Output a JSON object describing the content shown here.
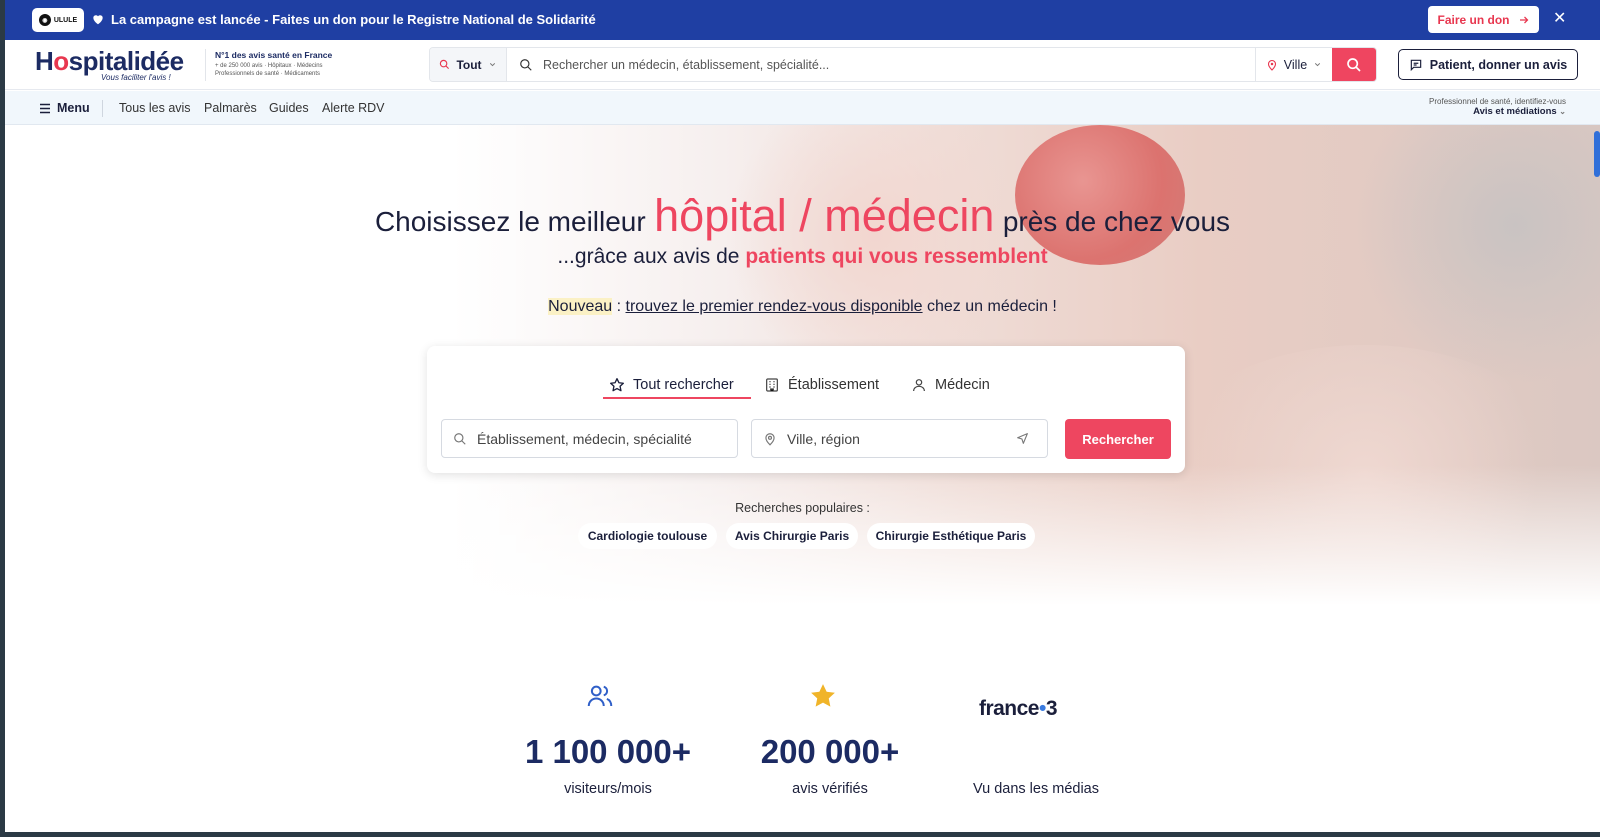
{
  "banner": {
    "logo_text": "ULULE",
    "message": "La campagne est lancée - Faites un don pour le Registre National de Solidarité",
    "donate_label": "Faire un don",
    "close_icon": "close-icon"
  },
  "header": {
    "logo_name": "Hospitalidée",
    "logo_tagline": "Vous faciliter l'avis !",
    "meta_title": "N°1 des avis santé en France",
    "meta_line1": "+ de 250 000 avis · Hôpitaux · Médecins",
    "meta_line2": "Professionnels de santé · Médicaments",
    "search_scope": "Tout",
    "search_placeholder": "Rechercher un médecin, établissement, spécialité...",
    "city_label": "Ville",
    "review_button": "Patient, donner un avis"
  },
  "nav": {
    "menu_label": "Menu",
    "links": [
      "Tous les avis",
      "Palmarès",
      "Guides",
      "Alerte RDV"
    ],
    "pro_line1": "Professionnel de santé, identifiez-vous",
    "pro_line2": "Avis et médiations"
  },
  "hero": {
    "headline_pre": "Choisissez le meilleur",
    "headline_highlight": "hôpital / médecin",
    "headline_post": "près de chez vous",
    "sub_pre": "...grâce aux avis de",
    "sub_highlight": "patients qui vous ressemblent",
    "nouveau_tag": "Nouveau",
    "nouveau_sep": " : ",
    "nouveau_link": "trouvez le premier rendez-vous disponible",
    "nouveau_post": " chez un médecin !"
  },
  "search_card": {
    "tabs": [
      {
        "label": "Tout rechercher",
        "icon": "star-icon",
        "active": true
      },
      {
        "label": "Établissement",
        "icon": "building-icon",
        "active": false
      },
      {
        "label": "Médecin",
        "icon": "person-icon",
        "active": false
      }
    ],
    "query_placeholder": "Établissement, médecin, spécialité",
    "location_placeholder": "Ville, région",
    "submit_label": "Rechercher"
  },
  "popular": {
    "label": "Recherches populaires :",
    "chips": [
      "Cardiologie toulouse",
      "Avis Chirurgie Paris",
      "Chirurgie Esthétique Paris"
    ]
  },
  "stats": [
    {
      "icon": "users-icon",
      "value": "1 100 000+",
      "label": "visiteurs/mois"
    },
    {
      "icon": "star-icon",
      "value": "200 000+",
      "label": "avis vérifiés"
    },
    {
      "icon": "france3-logo",
      "value": "france•3",
      "label": "Vu dans les médias"
    }
  ],
  "colors": {
    "brand_navy": "#1c2b63",
    "accent_pink": "#ee4660",
    "banner_blue": "#1f3fa3",
    "star_gold": "#f0b429"
  }
}
